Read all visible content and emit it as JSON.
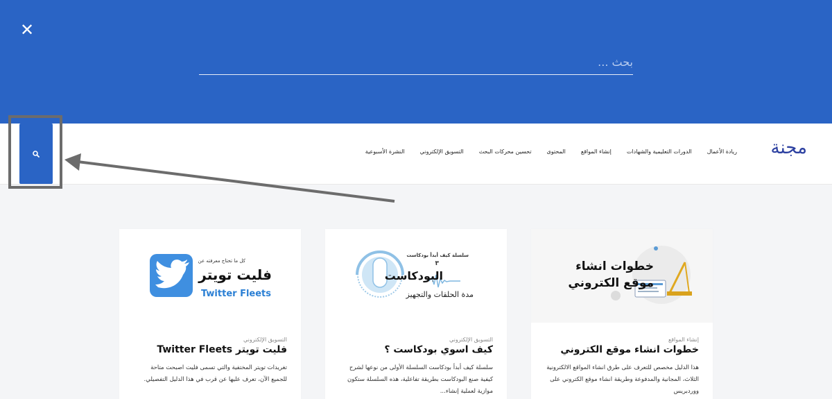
{
  "overlay": {
    "close_glyph": "✕",
    "search_placeholder": "بحث ..."
  },
  "header": {
    "logo": "مجنة",
    "nav": [
      "النشرة الأسبوعية",
      "التسويق الإلكتروني",
      "تحسين محركات البحث",
      "المحتوى",
      "إنشاء المواقع",
      "الدورات التعليمية والشهادات",
      "ريادة الأعمال"
    ],
    "search_button_icon": "search-icon"
  },
  "cards": [
    {
      "category": "إنشاء المواقع",
      "title": "خطوات انشاء موقع الكتروني",
      "excerpt": "هذا الدليل مخصص للتعرف على طرق انشاء المواقع الالكترونية الثلاث، المجانية والمدفوعة وطريقة انشاء موقع الكتروني على ووردبريس",
      "thumb": {
        "line1": "خطوات انشاء",
        "line2": "موقع الكتروني"
      }
    },
    {
      "category": "التسويق الإلكتروني",
      "title": "كيف اسوي بودكاست ؟",
      "excerpt": "سلسلة كيف أبدأ بودكاست  السلسلة الأولى من نوعها لشرح كيفية صنع البودكاست بطريقة تفاعلية، هذه السلسلة ستكون موازية لعملية إنشاء...",
      "thumb": {
        "top": "سلسلة كيف أبدأ بودكاست",
        "num": "٣",
        "main": "البودكاست",
        "sub": "مدة الحلقات والتجهيز"
      }
    },
    {
      "category": "التسويق الإلكتروني",
      "title": "فليت تويتر Twitter Fleets",
      "excerpt": "تغريدات تويتر المختفية والتي تسمى فليت اصبحت متاحة للجميع الآن، تعرف عليها عن قرب في هذا الدليل التفصيلي.",
      "thumb": {
        "top": "كل ما تحتاج معرفته عن",
        "main": "فليت تويتر",
        "sub": "Twitter Fleets"
      }
    }
  ],
  "colors": {
    "brand_blue": "#2a64c5",
    "logo": "#2b3fa0",
    "annotation_gray": "#6c6c6c"
  }
}
